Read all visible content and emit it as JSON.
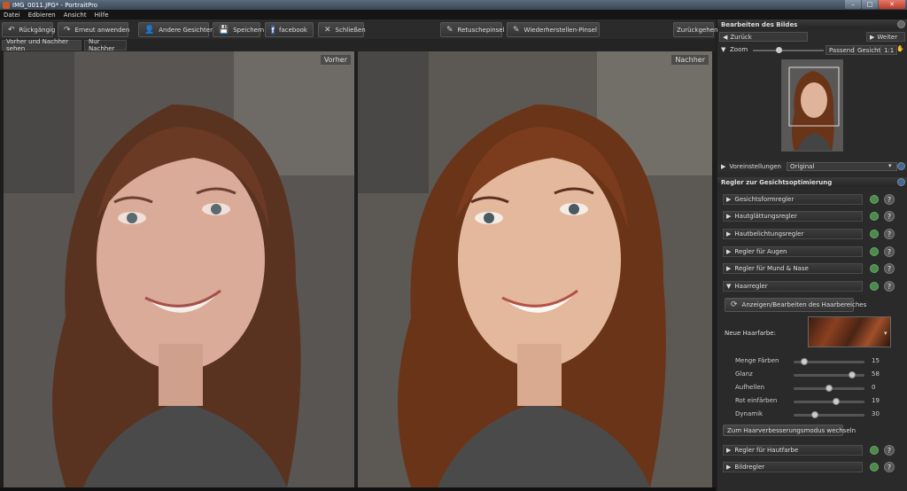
{
  "window": {
    "title": "IMG_0011.JPG* - PortraitPro",
    "min": "–",
    "max": "□",
    "close": "✕"
  },
  "menu": [
    "Datei",
    "Edbieren",
    "Ansicht",
    "Hilfe"
  ],
  "toolbar": {
    "undo": "Rückgängig",
    "redo": "Erneut anwenden",
    "other_faces": "Andere Gesichter",
    "save": "Speichern",
    "facebook": "facebook",
    "close": "Schließen",
    "retouch_brush": "Retuschepinsel",
    "restore_brush": "Wiederherstellen-Pinsel",
    "reset": "Zurückgehen"
  },
  "view_tabs": [
    "Vorher und Nachher sehen",
    "Nur Nachher"
  ],
  "labels": {
    "before": "Vorher",
    "after": "Nachher"
  },
  "sidebar": {
    "edit_title": "Bearbeiten des Bildes",
    "back": "Zurück",
    "next": "Weiter",
    "zoom": "Zoom",
    "zoom_fit": "Passend",
    "zoom_face": "Gesicht",
    "zoom_1to1": "1:1",
    "presets_label": "Voreinstellungen",
    "presets_value": "Original",
    "regler_title": "Regler zur Gesichtsoptimierung",
    "regler": [
      "Gesichtsformregler",
      "Hautglättungsregler",
      "Hautbelichtungsregler",
      "Regler für Augen",
      "Regler für Mund & Nase",
      "Haarregler"
    ],
    "hair_show_btn": "Anzeigen/Bearbeiten des Haarbereiches",
    "new_hair_color": "Neue Haarfarbe:",
    "sliders": [
      {
        "label": "Menge Färben",
        "value": 15
      },
      {
        "label": "Glanz",
        "value": 58
      },
      {
        "label": "Aufhellen",
        "value": 0
      },
      {
        "label": "Rot einfärben",
        "value": 19
      },
      {
        "label": "Dynamik",
        "value": 30
      }
    ],
    "hair_mode_btn": "Zum Haarverbesserungsmodus wechseln",
    "regler_bottom": [
      "Regler für Hautfarbe",
      "Bildregler"
    ]
  }
}
